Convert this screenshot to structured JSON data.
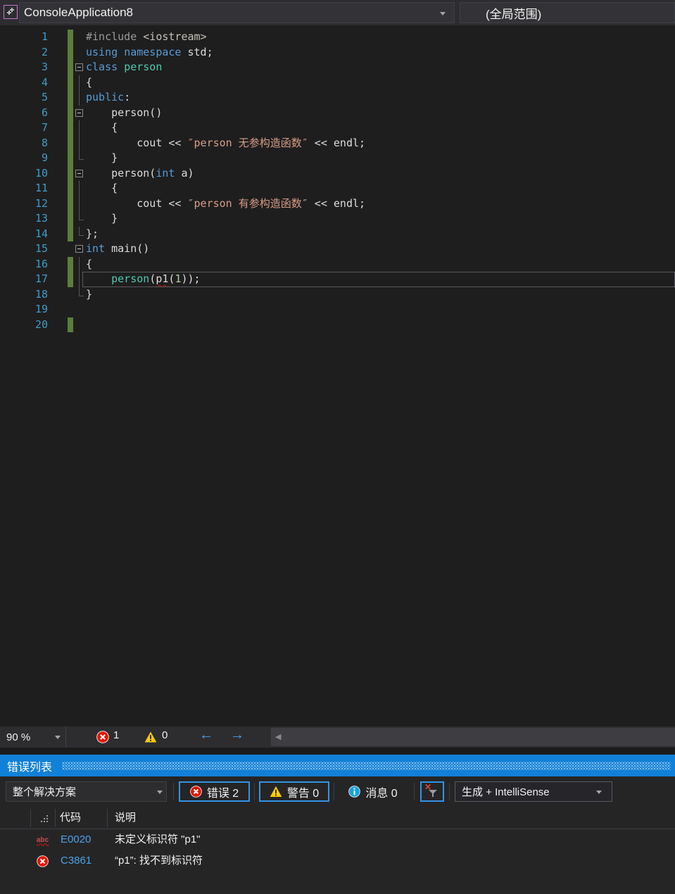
{
  "colors": {
    "panel_title_blue": "#1180D8",
    "selected_button_border": "#3294E4",
    "error_red": "#E51400",
    "warning_yellow": "#FFCC00",
    "info_blue": "#1BA1E2",
    "change_bar_green": "#5B7E3B",
    "link_blue": "#4CA2E8",
    "keyword_blue": "#569CD6",
    "type_teal": "#4EC9B0",
    "string_orange": "#D69D85"
  },
  "navbar": {
    "project": "ConsoleApplication8",
    "scope": "(全局范围)"
  },
  "editor": {
    "lines": [
      {
        "n": "1",
        "chg": true,
        "fold": "",
        "cur": false,
        "seg": [
          [
            "pp",
            "#include "
          ],
          [
            "inc",
            "<iostream>"
          ]
        ]
      },
      {
        "n": "2",
        "chg": true,
        "fold": "",
        "cur": false,
        "seg": [
          [
            "kw",
            "using"
          ],
          [
            "txt",
            " "
          ],
          [
            "kw",
            "namespace"
          ],
          [
            "txt",
            " std;"
          ]
        ]
      },
      {
        "n": "3",
        "chg": true,
        "fold": "box",
        "cur": false,
        "seg": [
          [
            "kw",
            "class"
          ],
          [
            "txt",
            " "
          ],
          [
            "type",
            "person"
          ]
        ]
      },
      {
        "n": "4",
        "chg": true,
        "fold": "v",
        "cur": false,
        "seg": [
          [
            "txt",
            "{"
          ]
        ]
      },
      {
        "n": "5",
        "chg": true,
        "fold": "v",
        "cur": false,
        "seg": [
          [
            "kw",
            "public"
          ],
          [
            "txt",
            ":"
          ]
        ]
      },
      {
        "n": "6",
        "chg": true,
        "fold": "box",
        "cur": false,
        "seg": [
          [
            "txt",
            "    person()"
          ]
        ]
      },
      {
        "n": "7",
        "chg": true,
        "fold": "v",
        "cur": false,
        "seg": [
          [
            "txt",
            "    {"
          ]
        ]
      },
      {
        "n": "8",
        "chg": true,
        "fold": "v",
        "cur": false,
        "seg": [
          [
            "txt",
            "        cout << "
          ],
          [
            "str",
            "″person 无参构造函数″"
          ],
          [
            "txt",
            " << endl;"
          ]
        ]
      },
      {
        "n": "9",
        "chg": true,
        "fold": "end",
        "cur": false,
        "seg": [
          [
            "txt",
            "    }"
          ]
        ]
      },
      {
        "n": "10",
        "chg": true,
        "fold": "box",
        "cur": false,
        "seg": [
          [
            "txt",
            "    person("
          ],
          [
            "kw",
            "int"
          ],
          [
            "txt",
            " a)"
          ]
        ]
      },
      {
        "n": "11",
        "chg": true,
        "fold": "v",
        "cur": false,
        "seg": [
          [
            "txt",
            "    {"
          ]
        ]
      },
      {
        "n": "12",
        "chg": true,
        "fold": "v",
        "cur": false,
        "seg": [
          [
            "txt",
            "        cout << "
          ],
          [
            "str",
            "″person 有参构造函数″"
          ],
          [
            "txt",
            " << endl;"
          ]
        ]
      },
      {
        "n": "13",
        "chg": true,
        "fold": "end",
        "cur": false,
        "seg": [
          [
            "txt",
            "    }"
          ]
        ]
      },
      {
        "n": "14",
        "chg": true,
        "fold": "end",
        "cur": false,
        "seg": [
          [
            "txt",
            "};"
          ]
        ]
      },
      {
        "n": "15",
        "chg": false,
        "fold": "box",
        "cur": false,
        "seg": [
          [
            "kw",
            "int"
          ],
          [
            "txt",
            " main()"
          ]
        ]
      },
      {
        "n": "16",
        "chg": true,
        "fold": "v",
        "cur": false,
        "seg": [
          [
            "txt",
            "{"
          ]
        ]
      },
      {
        "n": "17",
        "chg": true,
        "fold": "v",
        "cur": true,
        "seg": [
          [
            "txt",
            "    "
          ],
          [
            "type",
            "person"
          ],
          [
            "txt",
            "("
          ],
          [
            "err",
            "p1"
          ],
          [
            "txt",
            "("
          ],
          [
            "num",
            "1"
          ],
          [
            "txt",
            "));"
          ]
        ]
      },
      {
        "n": "18",
        "chg": false,
        "fold": "end",
        "cur": false,
        "seg": [
          [
            "txt",
            "}"
          ]
        ]
      },
      {
        "n": "19",
        "chg": false,
        "fold": "",
        "cur": false,
        "seg": []
      },
      {
        "n": "20",
        "chg": true,
        "fold": "",
        "cur": false,
        "seg": []
      }
    ]
  },
  "statusbar": {
    "zoom": "90 %",
    "error_count": "1",
    "warning_count": "0"
  },
  "error_list": {
    "title": "错误列表",
    "toolbar": {
      "scope": "整个解决方案",
      "errors_label": "错误 2",
      "warnings_label": "警告 0",
      "messages_label": "消息 0",
      "build_filter": "生成 + IntelliSense"
    },
    "columns": {
      "code": "代码",
      "description": "说明"
    },
    "rows": [
      {
        "icon": "intellisense-squiggle",
        "icon_text": "abc",
        "code": "E0020",
        "description": "未定义标识符 \"p1\""
      },
      {
        "icon": "error",
        "icon_text": "",
        "code": "C3861",
        "description": "“p1”: 找不到标识符"
      }
    ]
  }
}
